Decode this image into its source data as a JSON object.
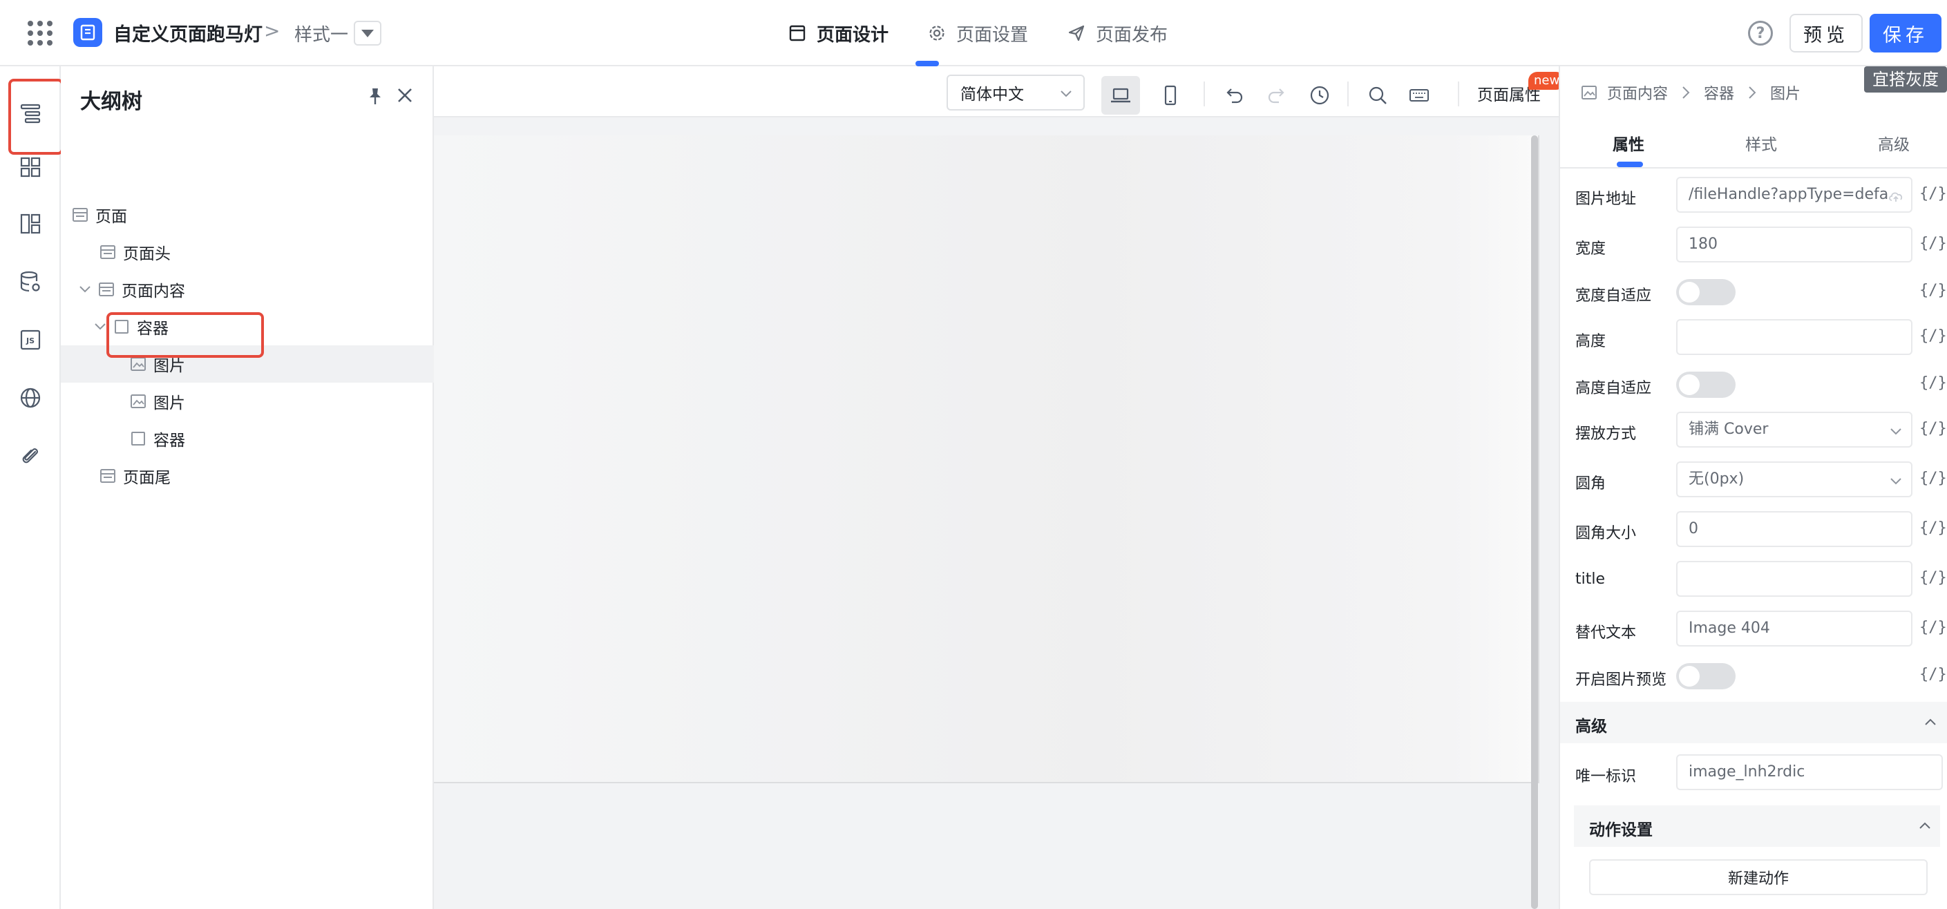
{
  "header": {
    "app_title": "自定义页面跑马灯",
    "breadcrumb_sep": ">",
    "style_name": "样式一",
    "tabs": [
      {
        "label": "页面设计"
      },
      {
        "label": "页面设置"
      },
      {
        "label": "页面发布"
      }
    ],
    "help": "?",
    "preview_label": "预览",
    "save_label": "保存"
  },
  "rail": {
    "items": [
      "outline-icon",
      "components-icon",
      "layout-icon",
      "datasource-icon",
      "js-icon",
      "globe-icon",
      "attachment-icon"
    ],
    "js_label": "JS"
  },
  "outline": {
    "title": "大纲树",
    "nodes": [
      {
        "label": "页面"
      },
      {
        "label": "页面头"
      },
      {
        "label": "页面内容"
      },
      {
        "label": "容器"
      },
      {
        "label": "图片"
      },
      {
        "label": "图片"
      },
      {
        "label": "容器"
      },
      {
        "label": "页面尾"
      }
    ]
  },
  "toolbar": {
    "language": "简体中文",
    "page_props": "页面属性",
    "new_badge": "new"
  },
  "props": {
    "breadcrumb": [
      "页面内容",
      "容器",
      "图片"
    ],
    "gray_tag": "宜搭灰度",
    "tabs": [
      "属性",
      "样式",
      "高级"
    ],
    "expr": "{/}",
    "fields": {
      "src_label": "图片地址",
      "src_value": "/fileHandle?appType=defa",
      "width_label": "宽度",
      "width_value": "180",
      "width_auto_label": "宽度自适应",
      "height_label": "高度",
      "height_value": "",
      "height_auto_label": "高度自适应",
      "fit_label": "摆放方式",
      "fit_value": "铺满 Cover",
      "radius_label": "圆角",
      "radius_value": "无(0px)",
      "radius_size_label": "圆角大小",
      "radius_size_value": "0",
      "title_label": "title",
      "title_value": "",
      "alt_label": "替代文本",
      "alt_value": "Image 404",
      "preview_label": "开启图片预览"
    },
    "advanced": {
      "title": "高级",
      "id_label": "唯一标识",
      "id_value": "image_lnh2rdic",
      "actions_title": "动作设置",
      "new_action": "新建动作"
    }
  }
}
